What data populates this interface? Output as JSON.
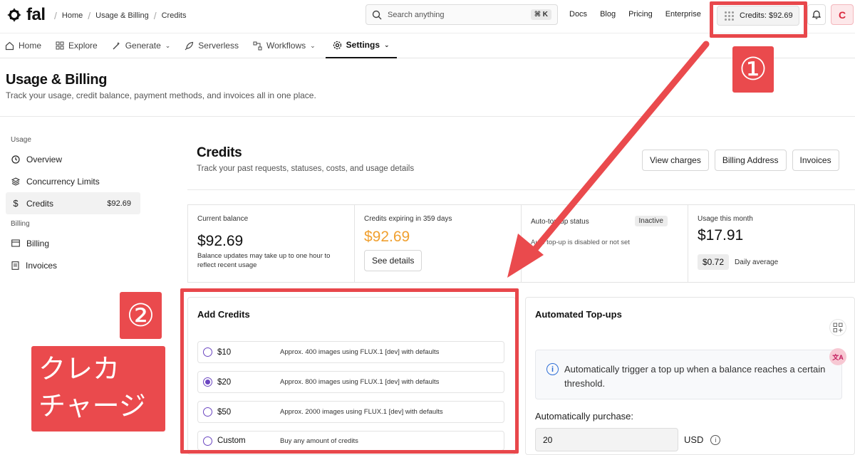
{
  "header": {
    "logo_text": "fal",
    "breadcrumb": [
      "Home",
      "Usage & Billing",
      "Credits"
    ],
    "search": {
      "placeholder": "Search anything",
      "shortcut": "⌘ K"
    },
    "links": [
      "Docs",
      "Blog",
      "Pricing",
      "Enterprise"
    ],
    "credits_label": "Credits: $92.69",
    "avatar_initial": "C"
  },
  "nav": {
    "items": [
      {
        "label": "Home",
        "icon": "home-icon"
      },
      {
        "label": "Explore",
        "icon": "grid-icon"
      },
      {
        "label": "Generate",
        "icon": "wand-icon"
      },
      {
        "label": "Serverless",
        "icon": "rocket-icon"
      },
      {
        "label": "Workflows",
        "icon": "workflow-icon"
      },
      {
        "label": "Settings",
        "icon": "gear-icon",
        "active": true
      }
    ]
  },
  "page": {
    "title": "Usage & Billing",
    "subtitle": "Track your usage, credit balance, payment methods, and invoices all in one place."
  },
  "sidebar": {
    "usage_heading": "Usage",
    "usage_items": [
      {
        "label": "Overview",
        "icon": "clock-icon"
      },
      {
        "label": "Concurrency Limits",
        "icon": "layers-icon"
      },
      {
        "label": "Credits",
        "icon": "dollar-icon",
        "value": "$92.69",
        "active": true
      }
    ],
    "billing_heading": "Billing",
    "billing_items": [
      {
        "label": "Billing",
        "icon": "card-icon"
      },
      {
        "label": "Invoices",
        "icon": "document-icon"
      }
    ]
  },
  "credits": {
    "title": "Credits",
    "subtitle": "Track your past requests, statuses, costs, and usage details",
    "buttons": [
      "View charges",
      "Billing Address",
      "Invoices"
    ]
  },
  "stats": {
    "balance": {
      "label": "Current balance",
      "value": "$92.69",
      "note": "Balance updates may take up to one hour to reflect recent usage"
    },
    "expiring": {
      "label": "Credits expiring in 359 days",
      "value": "$92.69",
      "button": "See details"
    },
    "topup": {
      "label": "Auto-top-up status",
      "badge": "Inactive",
      "note": "Auto top-up is disabled or not set"
    },
    "usage": {
      "label": "Usage this month",
      "value": "$17.91",
      "daily_value": "$0.72",
      "daily_label": "Daily average"
    }
  },
  "add_credits": {
    "title": "Add Credits",
    "options": [
      {
        "amount": "$10",
        "desc": "Approx. 400 images using FLUX.1 [dev] with defaults"
      },
      {
        "amount": "$20",
        "desc": "Approx. 800 images using FLUX.1 [dev] with defaults",
        "selected": true
      },
      {
        "amount": "$50",
        "desc": "Approx. 2000 images using FLUX.1 [dev] with defaults"
      },
      {
        "amount": "Custom",
        "desc": "Buy any amount of credits"
      }
    ]
  },
  "auto_topups": {
    "title": "Automated Top-ups",
    "info": "Automatically trigger a top up when a balance reaches a certain threshold.",
    "purchase_label": "Automatically purchase:",
    "purchase_value": "20",
    "currency": "USD"
  },
  "annotations": {
    "step1": "①",
    "step2": "②",
    "japanese_label_line1": "クレカ",
    "japanese_label_line2": "チャージ",
    "accent_color": "#e8474b"
  }
}
